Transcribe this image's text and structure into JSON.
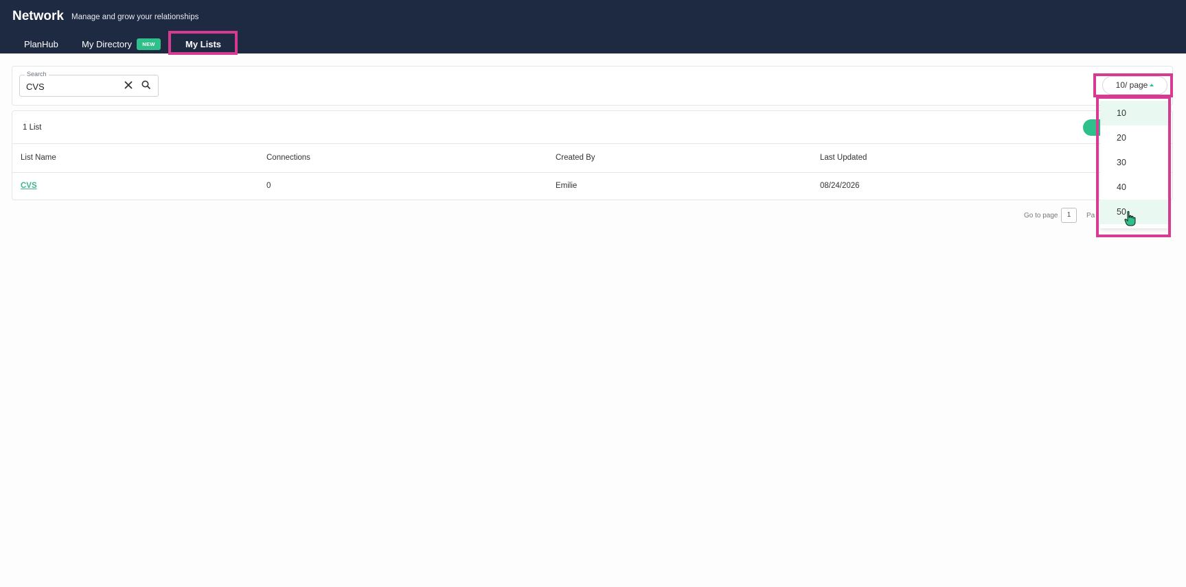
{
  "header": {
    "title": "Network",
    "subtitle": "Manage and grow your relationships",
    "tabs": [
      {
        "label": "PlanHub"
      },
      {
        "label": "My Directory",
        "badge": "NEW"
      },
      {
        "label": "My Lists"
      }
    ]
  },
  "search": {
    "label": "Search",
    "value": "CVS"
  },
  "pagination": {
    "page_size_label": "10/ page",
    "page_size_options": [
      "10",
      "20",
      "30",
      "40",
      "50"
    ],
    "goto_label": "Go to page",
    "goto_value": "1",
    "page_label_partial": "Pa"
  },
  "list_summary": {
    "count_label": "1 List"
  },
  "table": {
    "columns": [
      "List Name",
      "Connections",
      "Created By",
      "Last Updated"
    ],
    "rows": [
      {
        "list_name": "CVS",
        "connections": "0",
        "created_by": "Emilie",
        "last_updated": "08/24/2026"
      }
    ]
  },
  "colors": {
    "header_bg": "#1e2a42",
    "accent": "#2fbf8a",
    "highlight": "#d63b91"
  }
}
